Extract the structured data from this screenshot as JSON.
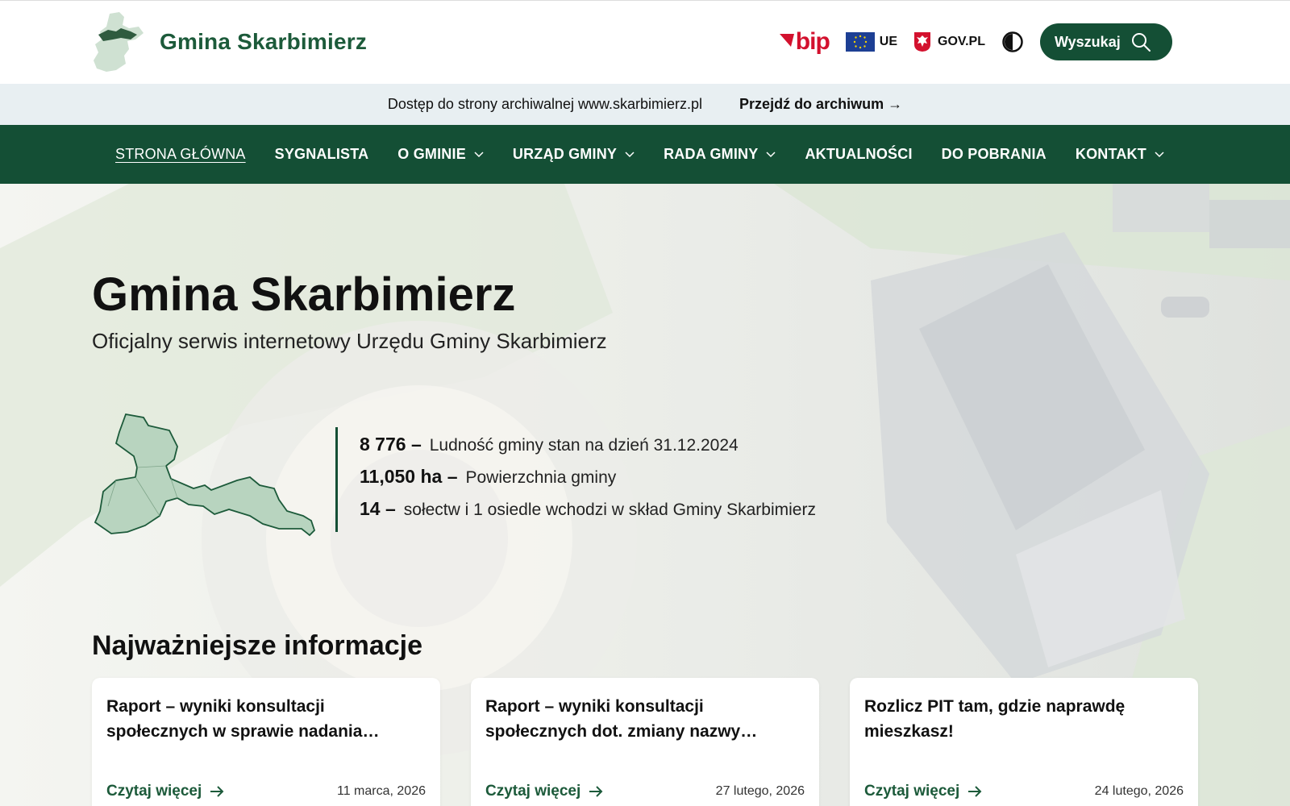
{
  "header": {
    "site_name": "Gmina Skarbimierz",
    "bip_label": "bip",
    "ue_label": "UE",
    "gov_label": "GOV.PL",
    "search_label": "Wyszukaj"
  },
  "archive": {
    "text": "Dostęp do strony archiwalnej www.skarbimierz.pl",
    "link": "Przejdź do archiwum →"
  },
  "nav": {
    "items": [
      {
        "label": "STRONA GŁÓWNA"
      },
      {
        "label": "SYGNALISTA"
      },
      {
        "label": "O GMINIE"
      },
      {
        "label": "URZĄD GMINY"
      },
      {
        "label": "RADA GMINY"
      },
      {
        "label": "AKTUALNOŚCI"
      },
      {
        "label": "DO POBRANIA"
      },
      {
        "label": "KONTAKT"
      }
    ]
  },
  "hero": {
    "title": "Gmina Skarbimierz",
    "subtitle": "Oficjalny serwis internetowy Urzędu Gminy Skarbimierz",
    "stats": [
      {
        "num": "8 776 –",
        "text": "Ludność gminy stan na dzień 31.12.2024"
      },
      {
        "num": "11,050 ha –",
        "text": "Powierzchnia gminy"
      },
      {
        "num": "14 –",
        "text": "sołectw i 1 osiedle wchodzi w skład Gminy Skarbimierz"
      }
    ]
  },
  "news": {
    "title": "Najważniejsze informacje",
    "read_more": "Czytaj więcej",
    "cards": [
      {
        "title": "Raport – wyniki konsultacji społecznych w sprawie nadania…",
        "date": "11 marca, 2026"
      },
      {
        "title": "Raport – wyniki konsultacji społecznych dot. zmiany nazwy…",
        "date": "27 lutego, 2026"
      },
      {
        "title": "Rozlicz PIT tam, gdzie naprawdę mieszkasz!",
        "date": "24 lutego, 2026"
      }
    ]
  },
  "colors": {
    "brand_green": "#144f35",
    "map_fill": "#b8d4bf",
    "bip_red": "#d3112e"
  }
}
